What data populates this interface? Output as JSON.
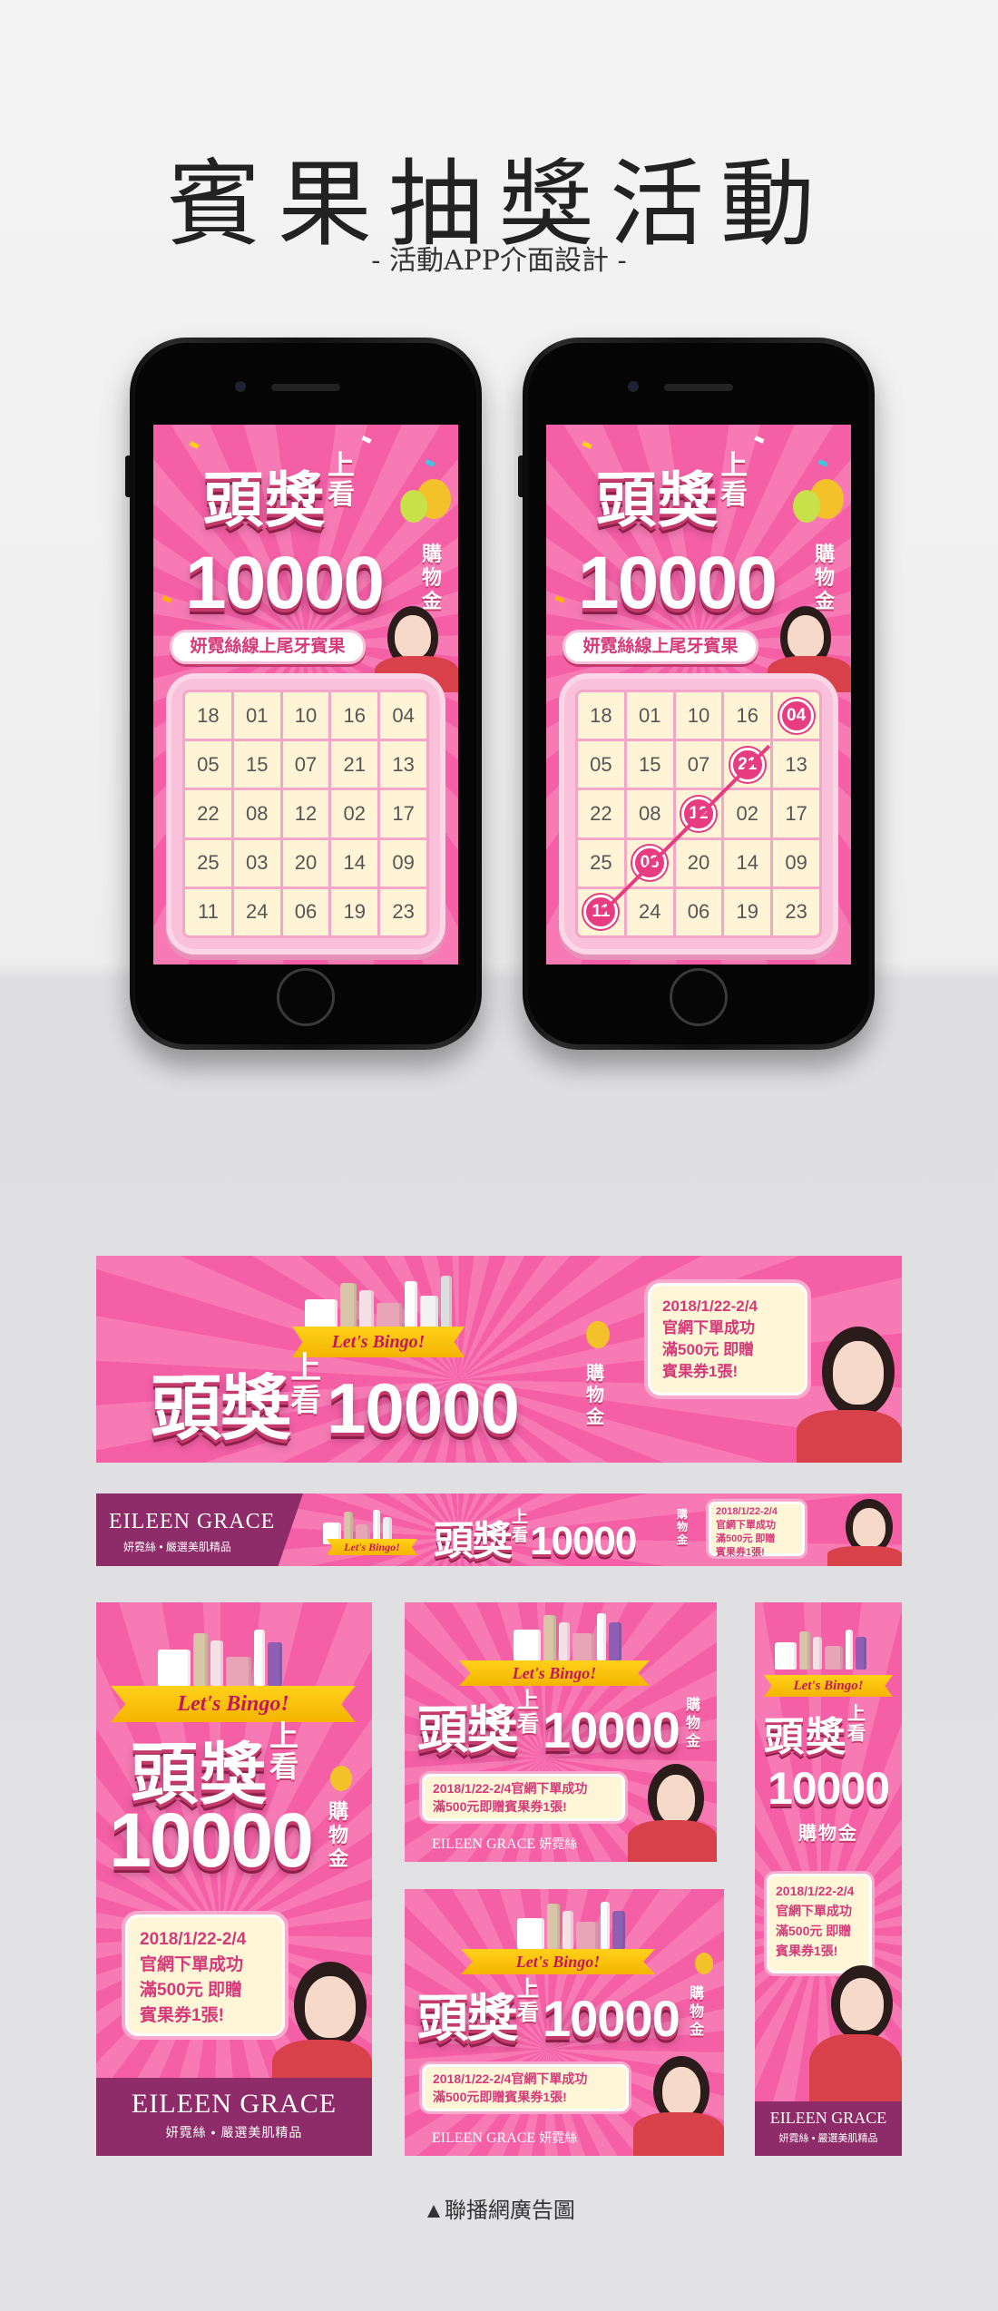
{
  "page": {
    "title": "賓果抽獎活動",
    "subtitle": "- 活動APP介面設計 -",
    "caption": "▲聯播網廣告圖"
  },
  "promo": {
    "headline_main": "頭獎",
    "headline_up": "上看",
    "amount": "10000",
    "amount_unit": "購物金",
    "tagline": "妍霓絲線上尾牙賓果",
    "ribbon": "Let's Bingo!",
    "date": "2018/1/22-2/4",
    "offer_line1": "官網下單成功",
    "offer_line2": "滿500元 即贈",
    "offer_line3": "賓果券1張!",
    "offer_short": "2018/1/22-2/4官網下單成功",
    "offer_short2": "滿500元即贈賓果券1張!",
    "brand": "EILEEN GRACE",
    "brand_cn": "妍霓絲",
    "brand_sub": "妍霓絲 • 嚴選美肌精品"
  },
  "bingo_left": [
    [
      "18",
      "01",
      "10",
      "16",
      "04"
    ],
    [
      "05",
      "15",
      "07",
      "21",
      "13"
    ],
    [
      "22",
      "08",
      "12",
      "02",
      "17"
    ],
    [
      "25",
      "03",
      "20",
      "14",
      "09"
    ],
    [
      "11",
      "24",
      "06",
      "19",
      "23"
    ]
  ],
  "bingo_right_hits": [
    "04",
    "21",
    "12",
    "03",
    "11"
  ],
  "colors": {
    "pink": "#f45fa6",
    "magenta": "#e73b82",
    "plum": "#8e2b69",
    "yellow": "#ffd11a"
  }
}
